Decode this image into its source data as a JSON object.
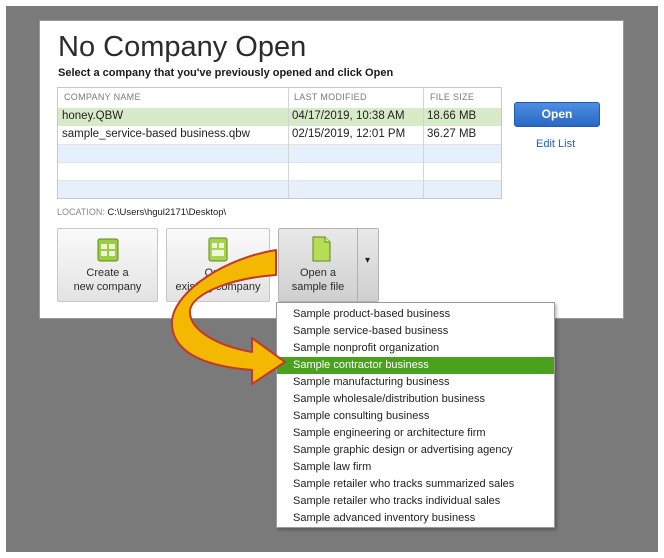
{
  "dialog": {
    "title": "No Company Open",
    "subtitle": "Select a company that you've previously opened and click Open"
  },
  "table": {
    "columns": [
      "COMPANY NAME",
      "LAST MODIFIED",
      "FILE SIZE"
    ],
    "rows": [
      {
        "name": "honey.QBW",
        "modified": "04/17/2019, 10:38 AM",
        "size": "18.66 MB"
      },
      {
        "name": "sample_service-based business.qbw",
        "modified": "02/15/2019, 12:01 PM",
        "size": "36.27 MB"
      }
    ]
  },
  "actions": {
    "open": "Open",
    "edit_list": "Edit List"
  },
  "location": {
    "label": "LOCATION:",
    "path": "C:\\Users\\hgul2171\\Desktop\\"
  },
  "big_buttons": [
    {
      "line1": "Create a",
      "line2": "new company",
      "icon": "new-company-icon"
    },
    {
      "line1": "Open",
      "line2": "existing company",
      "icon": "existing-company-icon"
    },
    {
      "line1": "Open a",
      "line2": "sample file",
      "icon": "sample-file-icon"
    }
  ],
  "dropdown_arrow": "▾",
  "sample_menu": {
    "selected_index": 3,
    "items": [
      "Sample product-based business",
      "Sample service-based business",
      "Sample nonprofit organization",
      "Sample contractor business",
      "Sample manufacturing business",
      "Sample wholesale/distribution business",
      "Sample consulting business",
      "Sample engineering or architecture firm",
      "Sample graphic design or advertising agency",
      "Sample law firm",
      "Sample retailer who tracks summarized sales",
      "Sample retailer who tracks individual sales",
      "Sample advanced inventory business"
    ]
  },
  "colors": {
    "background": "#7a7a7a",
    "selected_row": "#d7ebc9",
    "alt_row": "#e6f0fb",
    "open_button": "#2f6fcf",
    "menu_highlight": "#4aa11e",
    "arrow_fill": "#f5b800",
    "arrow_stroke": "#c0392b"
  }
}
